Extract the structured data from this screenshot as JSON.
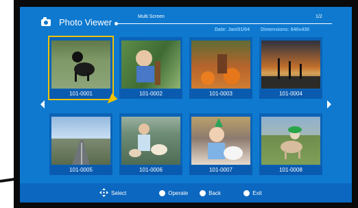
{
  "header": {
    "title": "Photo Viewer",
    "mode": "Multi Screen",
    "page": "1/2",
    "date_label": "Date: Jan/01/04",
    "dimensions_label": "Dimensions: 640x430"
  },
  "thumbnails": [
    {
      "label": "101-0001",
      "selected": true
    },
    {
      "label": "101-0002",
      "selected": false
    },
    {
      "label": "101-0003",
      "selected": false
    },
    {
      "label": "101-0004",
      "selected": false
    },
    {
      "label": "101-0005",
      "selected": false
    },
    {
      "label": "101-0006",
      "selected": false
    },
    {
      "label": "101-0007",
      "selected": false
    },
    {
      "label": "101-0008",
      "selected": false
    }
  ],
  "footer": {
    "select": "Select",
    "operate": "Operate",
    "back": "Back",
    "exit": "Exit"
  },
  "colors": {
    "screen": "#0e79cf",
    "highlight": "#f3c200"
  }
}
